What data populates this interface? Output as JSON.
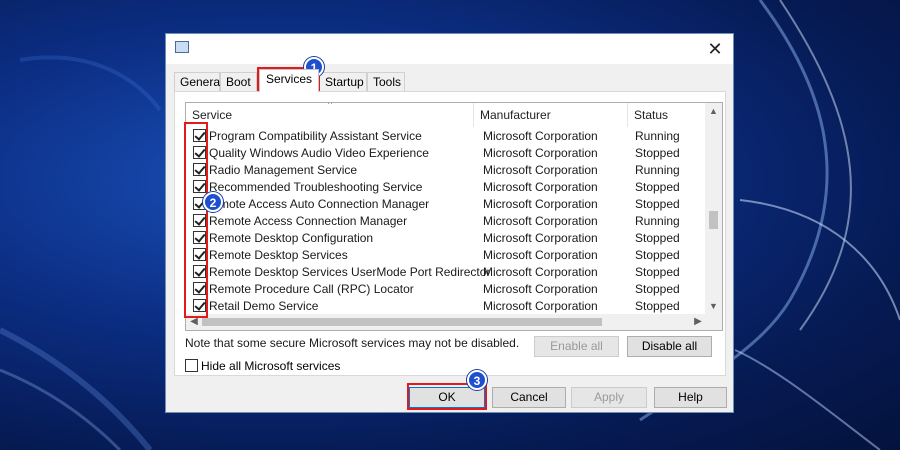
{
  "dialog": {
    "close_glyph": "✕",
    "tabs": [
      {
        "label": "General"
      },
      {
        "label": "Boot"
      },
      {
        "label": "Services"
      },
      {
        "label": "Startup"
      },
      {
        "label": "Tools"
      }
    ],
    "active_tab": "Services",
    "columns": {
      "service": "Service",
      "manufacturer": "Manufacturer",
      "status": "Status"
    },
    "services": [
      {
        "name": "Program Compatibility Assistant Service",
        "manufacturer": "Microsoft Corporation",
        "status": "Running",
        "checked": true
      },
      {
        "name": "Quality Windows Audio Video Experience",
        "manufacturer": "Microsoft Corporation",
        "status": "Stopped",
        "checked": true
      },
      {
        "name": "Radio Management Service",
        "manufacturer": "Microsoft Corporation",
        "status": "Running",
        "checked": true
      },
      {
        "name": "Recommended Troubleshooting Service",
        "manufacturer": "Microsoft Corporation",
        "status": "Stopped",
        "checked": true
      },
      {
        "name": "mote Access Auto Connection Manager",
        "manufacturer": "Microsoft Corporation",
        "status": "Stopped",
        "checked": true
      },
      {
        "name": "Remote Access Connection Manager",
        "manufacturer": "Microsoft Corporation",
        "status": "Running",
        "checked": true
      },
      {
        "name": "Remote Desktop Configuration",
        "manufacturer": "Microsoft Corporation",
        "status": "Stopped",
        "checked": true
      },
      {
        "name": "Remote Desktop Services",
        "manufacturer": "Microsoft Corporation",
        "status": "Stopped",
        "checked": true
      },
      {
        "name": "Remote Desktop Services UserMode Port Redirector",
        "manufacturer": "Microsoft Corporation",
        "status": "Stopped",
        "checked": true
      },
      {
        "name": "Remote Procedure Call (RPC) Locator",
        "manufacturer": "Microsoft Corporation",
        "status": "Stopped",
        "checked": true
      },
      {
        "name": "Retail Demo Service",
        "manufacturer": "Microsoft Corporation",
        "status": "Stopped",
        "checked": true
      }
    ],
    "note": "Note that some secure Microsoft services may not be disabled.",
    "enable_all_label": "Enable all",
    "disable_all_label": "Disable all",
    "hide_ms_label": "Hide all Microsoft services",
    "hide_ms_checked": false,
    "buttons": {
      "ok": "OK",
      "cancel": "Cancel",
      "apply": "Apply",
      "help": "Help"
    }
  },
  "annotations": {
    "step1": "1",
    "step2": "2",
    "step3": "3",
    "color": "#e21a1a",
    "badge_color": "#1e4fd0"
  },
  "icons": {
    "app": "msconfig-icon",
    "close": "close-icon",
    "scroll_up": "▲",
    "scroll_down": "▼",
    "scroll_left": "◀",
    "scroll_right": "▶",
    "sort": "^"
  }
}
